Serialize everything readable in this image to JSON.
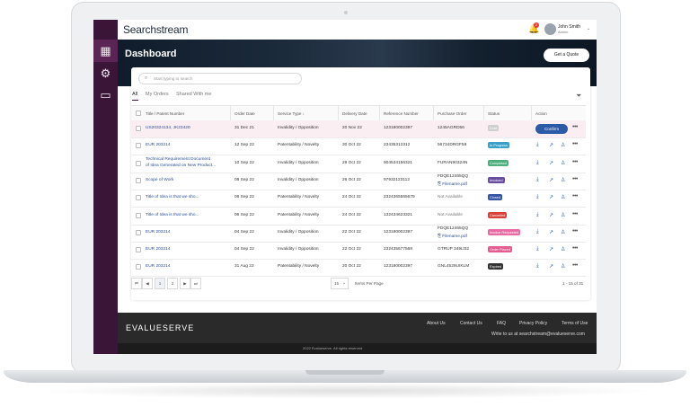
{
  "app": {
    "logo": "Searchstream",
    "notification_count": "2"
  },
  "user": {
    "name": "John Smith",
    "role": "Admin"
  },
  "hero": {
    "title": "Dashboard",
    "quote_button": "Get a Quote"
  },
  "search": {
    "placeholder": "Start typing to search"
  },
  "tabs": [
    "All",
    "My Orders",
    "Shared With me"
  ],
  "table": {
    "headers": [
      "Title / Patent Number",
      "Order Date",
      "Service Type",
      "Delivery Date",
      "Reference Number",
      "Purchase Order",
      "Status",
      "Action"
    ],
    "sort_indicator": "↓",
    "rows": [
      {
        "title": "US20324134, JK23420",
        "order_date": "31 Dec 21",
        "service": "Invalidity / Opposition",
        "delivery": "20 Nov 22",
        "ref": "123180002397",
        "po": "1245AGRD56",
        "po_file": "",
        "status": "Draft",
        "status_color": "#cfcfcf",
        "confirm": "Confirm"
      },
      {
        "title": "EUR 203214",
        "order_date": "12 Sep 22",
        "service": "Patentability / Novelty",
        "delivery": "30 Oct 22",
        "ref": "23435312312",
        "po": "56734DRGF59",
        "po_file": "",
        "status": "In Progress",
        "status_color": "#3aa0c8"
      },
      {
        "title": "Technical Requirement Document of Idea Generated on New Product...",
        "title2": "of Idea Generated on New Product...",
        "title1": "Technical Requirement Document",
        "order_date": "10 Sep 22",
        "service": "Invalidity / Opposition",
        "delivery": "29 Oct 22",
        "ref": "904534156321",
        "po": "FURAN90324N",
        "po_file": "",
        "status": "Completed",
        "status_color": "#4caf7d"
      },
      {
        "title": "Scope of Work",
        "order_date": "08 Sep 22",
        "service": "Invalidity / Opposition",
        "delivery": "26 Oct 22",
        "ref": "97932123112",
        "po": "FDQE12465QQ",
        "po_file": "Filename.pdf",
        "status": "Invoiced",
        "status_color": "#6a4fa0"
      },
      {
        "title": "Title of Idea is that we sho...",
        "order_date": "06 Sep 22",
        "service": "Patentability / Novelty",
        "delivery": "24 Oct 22",
        "ref": "2324365565679",
        "po": "Not Available",
        "po_file": "",
        "status": "Closed",
        "status_color": "#3656a8"
      },
      {
        "title": "Title of Idea is that we sho...",
        "order_date": "06 Sep 22",
        "service": "Patentability / Novelty",
        "delivery": "24 Oct 22",
        "ref": "132434623321",
        "po": "Not Available",
        "po_file": "",
        "status": "Cancelled",
        "status_color": "#d9423a"
      },
      {
        "title": "EUR 203214",
        "order_date": "04 Sep 22",
        "service": "Invalidity / Opposition",
        "delivery": "22 Oct 22",
        "ref": "123180002397",
        "po": "FDQE12465QQ",
        "po_file": "Filename.pdf",
        "status": "Invoice Requested",
        "status_color": "#e86ba4"
      },
      {
        "title": "EUR 203214",
        "order_date": "04 Sep 22",
        "service": "Invalidity / Opposition",
        "delivery": "22 Oct 22",
        "ref": "232435677568",
        "po": "GTRUP 349IJ32",
        "po_file": "",
        "status": "Order Placed",
        "status_color": "#e35b8f"
      },
      {
        "title": "EUR 203214",
        "order_date": "31 Aug 22",
        "service": "Patentability / Novelty",
        "delivery": "20 Oct 22",
        "ref": "123180002397",
        "po": "GNL4529UIKLM",
        "po_file": "",
        "status": "Expired",
        "status_color": "#333333"
      }
    ]
  },
  "pagination": {
    "first": "⏮",
    "prev": "◀",
    "pages": [
      "1",
      "2"
    ],
    "next": "▶",
    "last": "⏭",
    "per_page": "15",
    "items_per_page_label": "Items Per Page",
    "range": "1 - 15 of 31"
  },
  "footer": {
    "brand": "EVALUESERVE",
    "links": [
      "About Us",
      "Contact Us",
      "FAQ",
      "Privacy Policy",
      "Terms of Use"
    ],
    "email": "Write to us at searchstream@evalueserve.com",
    "copyright": "2022 Evalueserve. All rights reserved."
  }
}
